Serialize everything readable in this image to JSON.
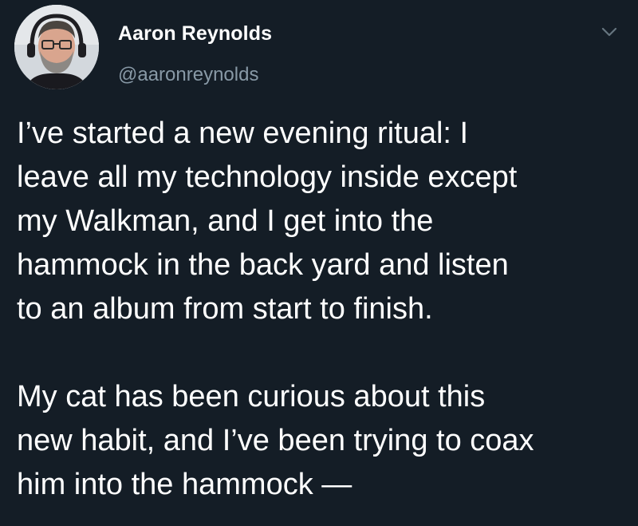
{
  "author": {
    "name": "Aaron Reynolds",
    "handle": "@aaronreynolds"
  },
  "icons": {
    "menu": "chevron-down-icon",
    "avatar": "profile-photo"
  },
  "colors": {
    "background": "#141d26",
    "text": "#ffffff",
    "secondary_text": "#8899a6"
  },
  "tweet": {
    "paragraphs": [
      {
        "lines": [
          "I’ve started a new evening ritual: I",
          "leave all my technology inside except",
          "my Walkman, and I get into the",
          "hammock in the back yard and listen",
          "to an album from start to finish."
        ]
      },
      {
        "lines": [
          "My cat has been curious about this",
          "new habit, and I’ve been trying to coax",
          "him into the hammock —"
        ]
      }
    ]
  }
}
